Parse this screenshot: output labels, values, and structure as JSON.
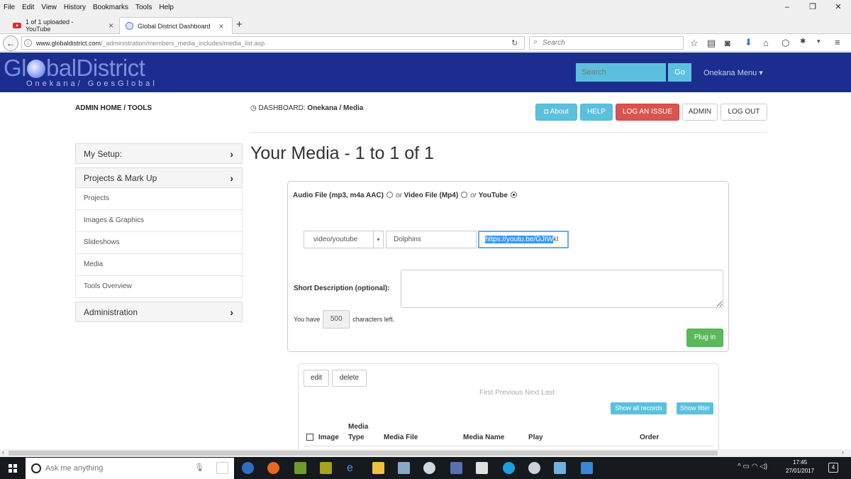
{
  "browser": {
    "menu": [
      "File",
      "Edit",
      "View",
      "History",
      "Bookmarks",
      "Tools",
      "Help"
    ],
    "window_controls": [
      "–",
      "❐",
      "✕"
    ],
    "tabs": [
      {
        "title": "1 of 1 uploaded - YouTube"
      },
      {
        "title": "Global District Dashboard"
      }
    ],
    "url_domain": "www.globaldistrict.com",
    "url_path": "/_administration/members_media_includes/media_list.asp",
    "search_placeholder": "Search"
  },
  "site": {
    "logo_pre": "Gl",
    "logo_post": "balDistrict",
    "tagline": "Onekana/ GoesGlobal",
    "search_placeholder": "Search",
    "go_label": "Go",
    "user_menu": "Onekana Menu ▾"
  },
  "header": {
    "admin_home": "ADMIN HOME / TOOLS",
    "dashboard_prefix": "DASHBOARD:",
    "dashboard_path": "Onekana / Media",
    "buttons": {
      "about": "About",
      "help": "HELP",
      "log_issue": "LOG AN ISSUE",
      "admin": "ADMIN",
      "logout": "LOG OUT"
    }
  },
  "sidebar": {
    "my_setup": "My Setup:",
    "projects_markup": "Projects & Mark Up",
    "items": [
      "Projects",
      "Images & Graphics",
      "Slideshows",
      "Media",
      "Tools Overview"
    ],
    "administration": "Administration"
  },
  "page": {
    "title": "Your Media - 1 to 1 of 1"
  },
  "form": {
    "opt_audio": "Audio File (mp3, m4a AAC)",
    "or1": "or",
    "opt_video": "Video File (Mp4)",
    "or2": "or",
    "opt_youtube": "YouTube",
    "selected": "youtube",
    "type_value": "video/youtube",
    "name_value": "Dolphins",
    "url_selected": "https://youtu.be/GJIW",
    "url_rest": "kl",
    "desc_label": "Short Description (optional):",
    "chars_prefix": "You have",
    "chars_count": "500",
    "chars_suffix": "characters left.",
    "plugin_label": "Plug in"
  },
  "list": {
    "edit_label": "edit",
    "delete_label": "delete",
    "pager": "First Previous Next Last",
    "show_all": "Show all records",
    "show_filter": "Show filter",
    "columns": {
      "image": "Image",
      "media_type_1": "Media",
      "media_type_2": "Type",
      "media_file": "Media File",
      "media_name": "Media Name",
      "play": "Play",
      "order": "Order"
    }
  },
  "taskbar": {
    "search_placeholder": "Ask me anything",
    "time": "17:45",
    "date": "27/01/2017",
    "notifications": "4"
  }
}
